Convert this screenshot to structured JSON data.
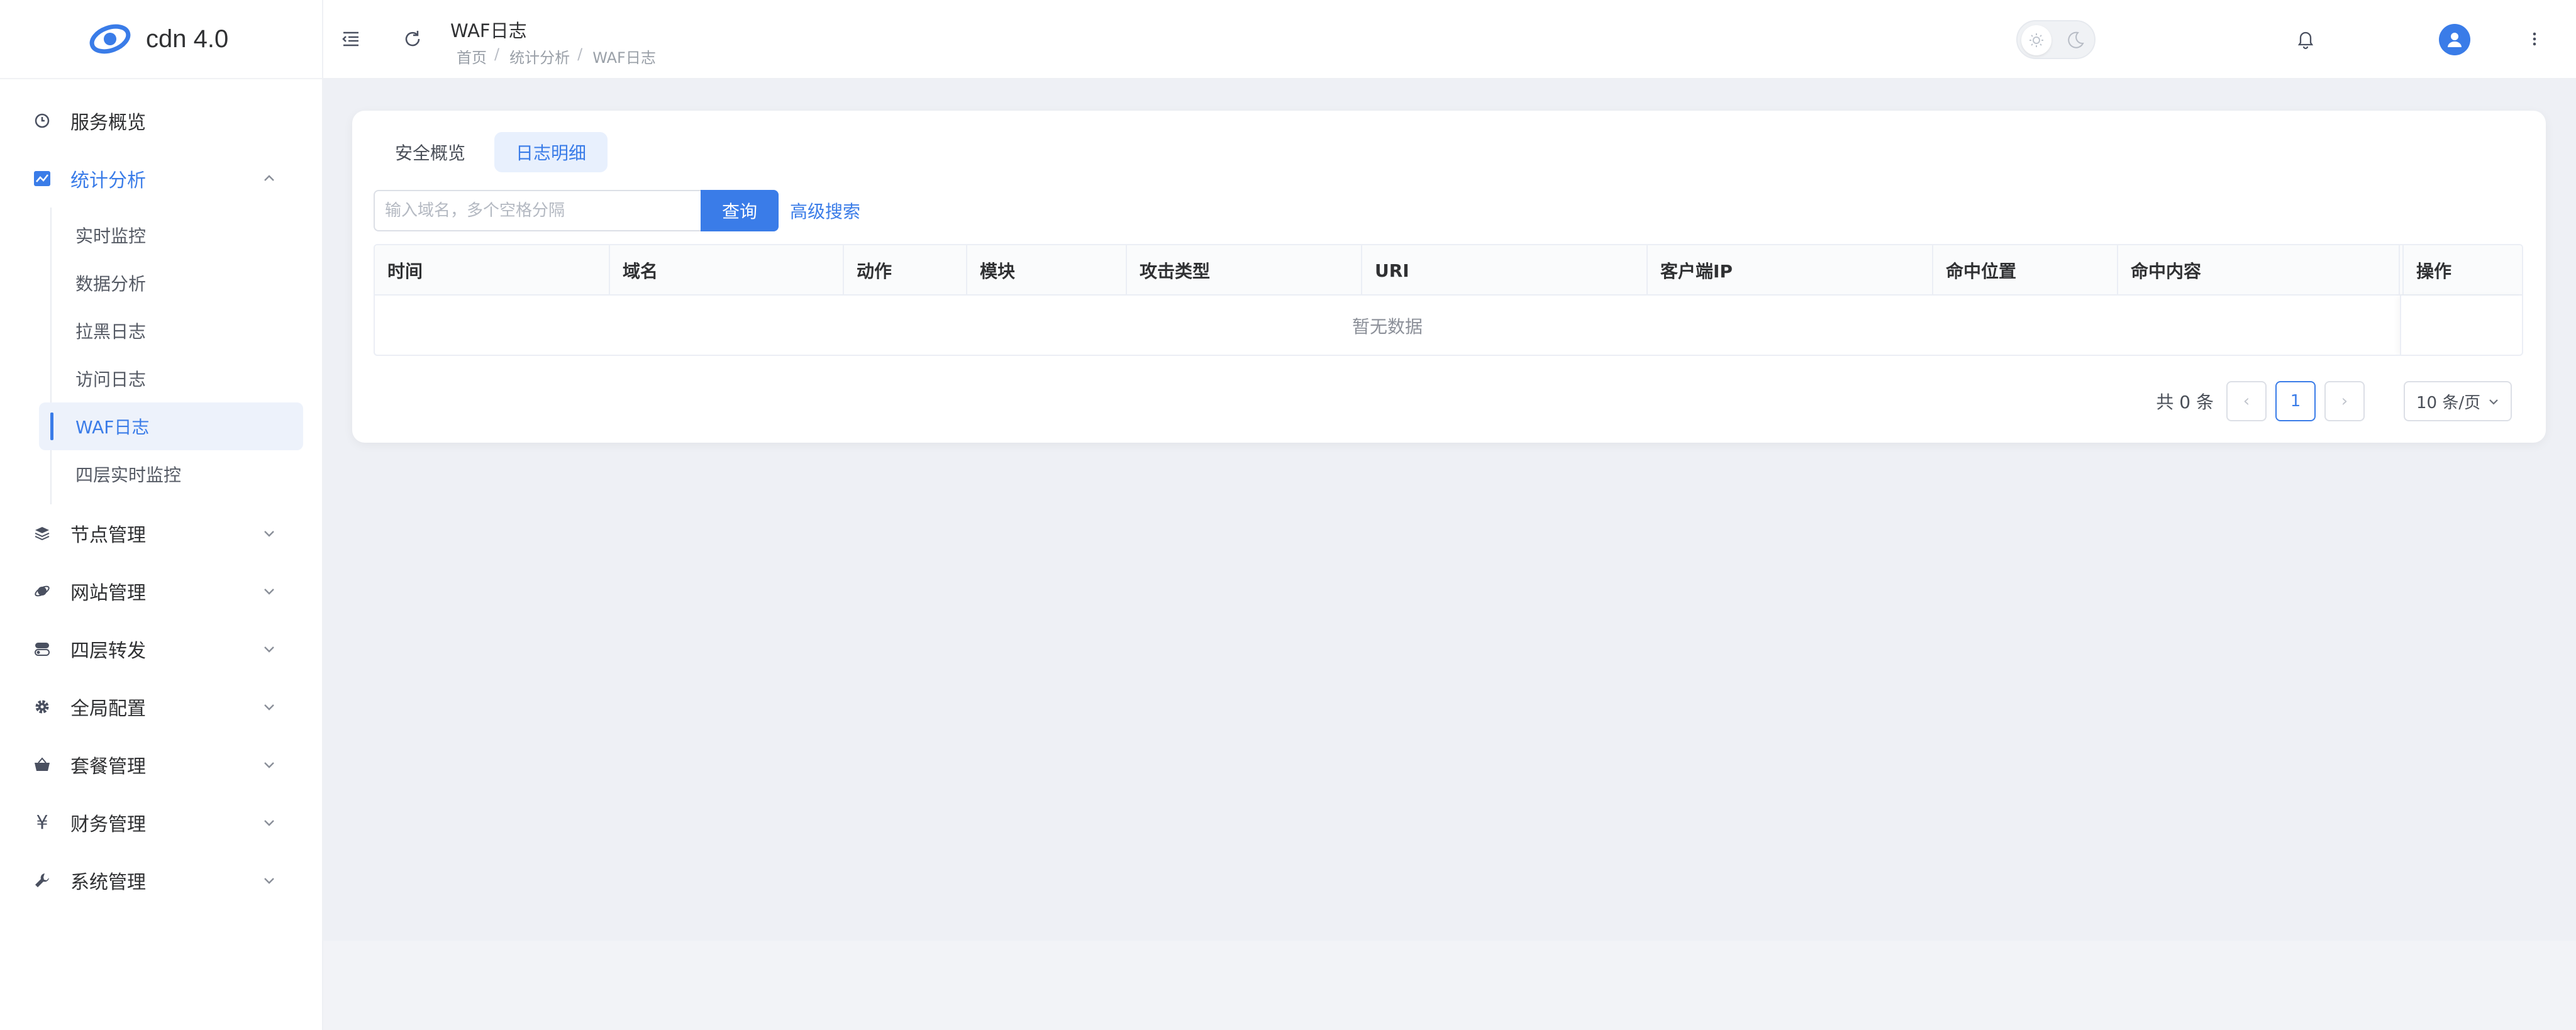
{
  "app": {
    "name": "cdn 4.0"
  },
  "sidebar": {
    "items": [
      {
        "label": "服务概览",
        "icon": "gauge-icon"
      },
      {
        "label": "统计分析",
        "icon": "chart-icon",
        "expanded": true,
        "children": [
          "实时监控",
          "数据分析",
          "拉黑日志",
          "访问日志",
          "WAF日志",
          "四层实时监控"
        ]
      },
      {
        "label": "节点管理",
        "icon": "layers-icon"
      },
      {
        "label": "网站管理",
        "icon": "planet-icon"
      },
      {
        "label": "四层转发",
        "icon": "toggle-icon"
      },
      {
        "label": "全局配置",
        "icon": "gear-icon"
      },
      {
        "label": "套餐管理",
        "icon": "basket-icon"
      },
      {
        "label": "财务管理",
        "icon": "yen-icon"
      },
      {
        "label": "系统管理",
        "icon": "wrench-icon"
      }
    ],
    "active_child": "WAF日志"
  },
  "header": {
    "title": "WAF日志",
    "breadcrumb": [
      "首页",
      "统计分析",
      "WAF日志"
    ]
  },
  "tabs": [
    {
      "label": "安全概览",
      "active": false
    },
    {
      "label": "日志明细",
      "active": true
    }
  ],
  "search": {
    "placeholder": "输入域名，多个空格分隔",
    "button": "查询",
    "advanced": "高级搜索"
  },
  "table": {
    "columns": [
      "时间",
      "域名",
      "动作",
      "模块",
      "攻击类型",
      "URI",
      "客户端IP",
      "命中位置",
      "命中内容",
      "操作"
    ],
    "empty_text": "暂无数据"
  },
  "pagination": {
    "total_text": "共 0 条",
    "prev": "‹",
    "current_page": "1",
    "next": "›",
    "page_size": "10 条/页"
  },
  "colors": {
    "accent": "#3a7ce8",
    "background": "#eef0f5"
  }
}
